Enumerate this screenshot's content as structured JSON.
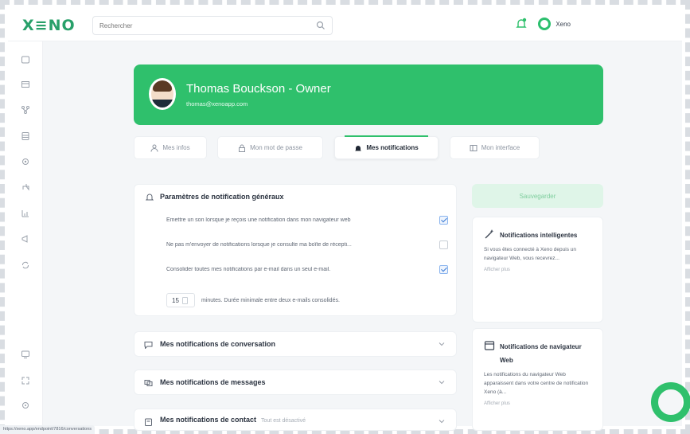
{
  "app": {
    "logo": "X≡NO",
    "brand_name": "Xeno"
  },
  "search": {
    "placeholder": "Rechercher"
  },
  "profile": {
    "name": "Thomas Bouckson - Owner",
    "email": "thomas@xenoapp.com"
  },
  "tabs": [
    {
      "label": "Mes infos",
      "icon": "user-icon"
    },
    {
      "label": "Mon mot de passe",
      "icon": "lock-icon"
    },
    {
      "label": "Mes notifications",
      "icon": "bell-icon"
    },
    {
      "label": "Mon interface",
      "icon": "layout-icon"
    }
  ],
  "general": {
    "title": "Paramètres de notification généraux",
    "options": [
      {
        "label": "Emettre un son lorsque je reçois une notification dans mon navigateur web",
        "checked": true
      },
      {
        "label": "Ne pas m'envoyer de notifications lorsque je consulte ma boîte de récepti...",
        "checked": false
      },
      {
        "label": "Consolider toutes mes notifications par e-mail dans un seul e-mail.",
        "checked": true
      }
    ],
    "minutes_value": "15",
    "minutes_text": "minutes. Durée minimale entre deux e-mails consolidés."
  },
  "sections": [
    {
      "label": "Mes notifications de conversation",
      "sub": ""
    },
    {
      "label": "Mes notifications de messages",
      "sub": ""
    },
    {
      "label": "Mes notifications de contact",
      "sub": "Tout est désactivé"
    }
  ],
  "save_label": "Sauvegarder",
  "cards": [
    {
      "title": "Notifications intelligentes",
      "desc": "Si vous êtes connecté à Xeno depuis un navigateur Web, vous recevrez...",
      "more": "Afficher plus"
    },
    {
      "title": "Notifications de navigateur Web",
      "desc": "Les notifications du navigateur Web apparaissent dans votre centre de notification Xeno (à...",
      "more": "Afficher plus"
    }
  ],
  "status_url": "https://xeno.app/endpoint/7816/conversations",
  "colors": {
    "accent": "#2fc06c",
    "check": "#3a7bd5"
  }
}
